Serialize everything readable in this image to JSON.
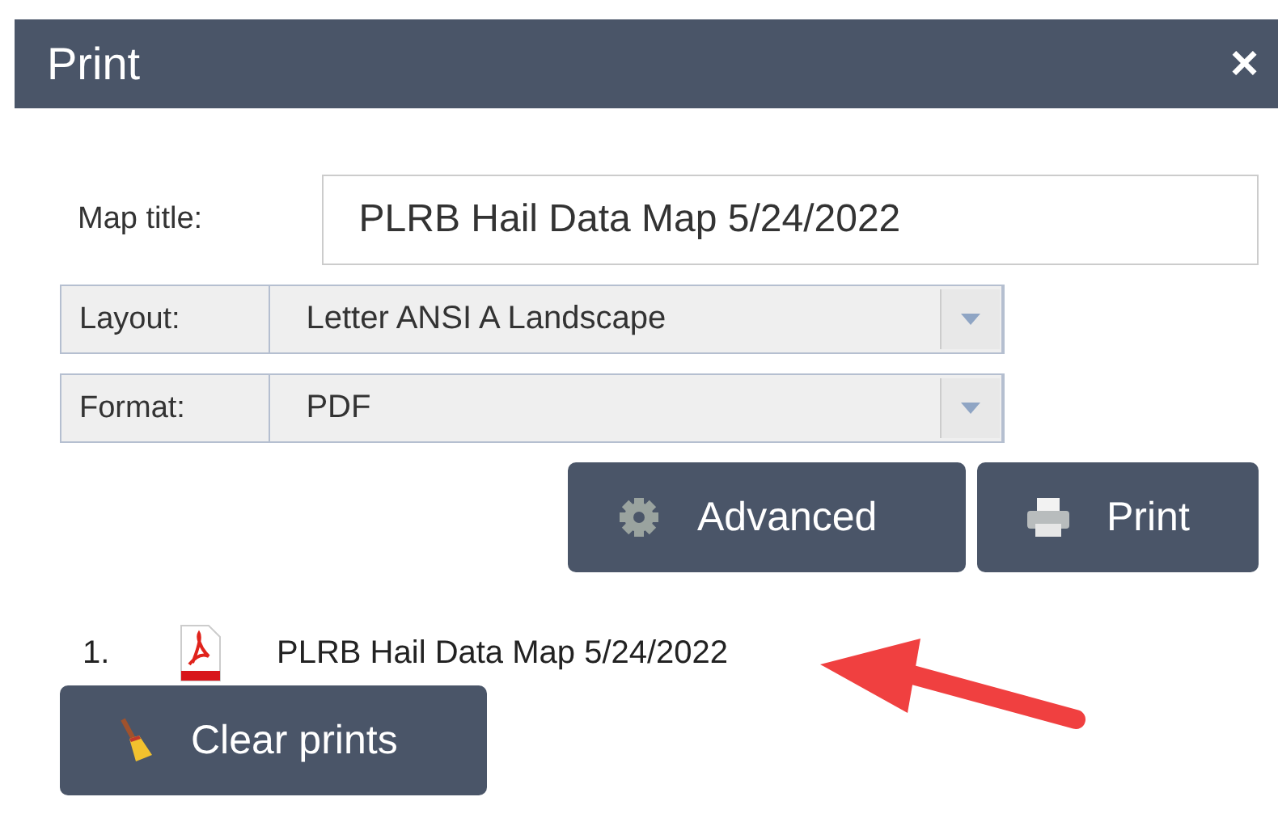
{
  "window": {
    "title": "Print",
    "close": "×"
  },
  "form": {
    "fields": [
      {
        "kind": "text",
        "label": "Map title:",
        "value": "PLRB Hail Data Map 5/24/2022"
      },
      {
        "kind": "select",
        "label": "Layout:",
        "value": "Letter ANSI A Landscape"
      },
      {
        "kind": "select",
        "label": "Format:",
        "value": "PDF"
      }
    ]
  },
  "buttons": [
    {
      "kind": "gear",
      "label": "Advanced"
    },
    {
      "kind": "printer",
      "label": "Print"
    }
  ],
  "prints": [
    {
      "number": "1.",
      "title": "PLRB Hail Data Map 5/24/2022"
    }
  ],
  "clear_button": {
    "label": "Clear prints"
  }
}
